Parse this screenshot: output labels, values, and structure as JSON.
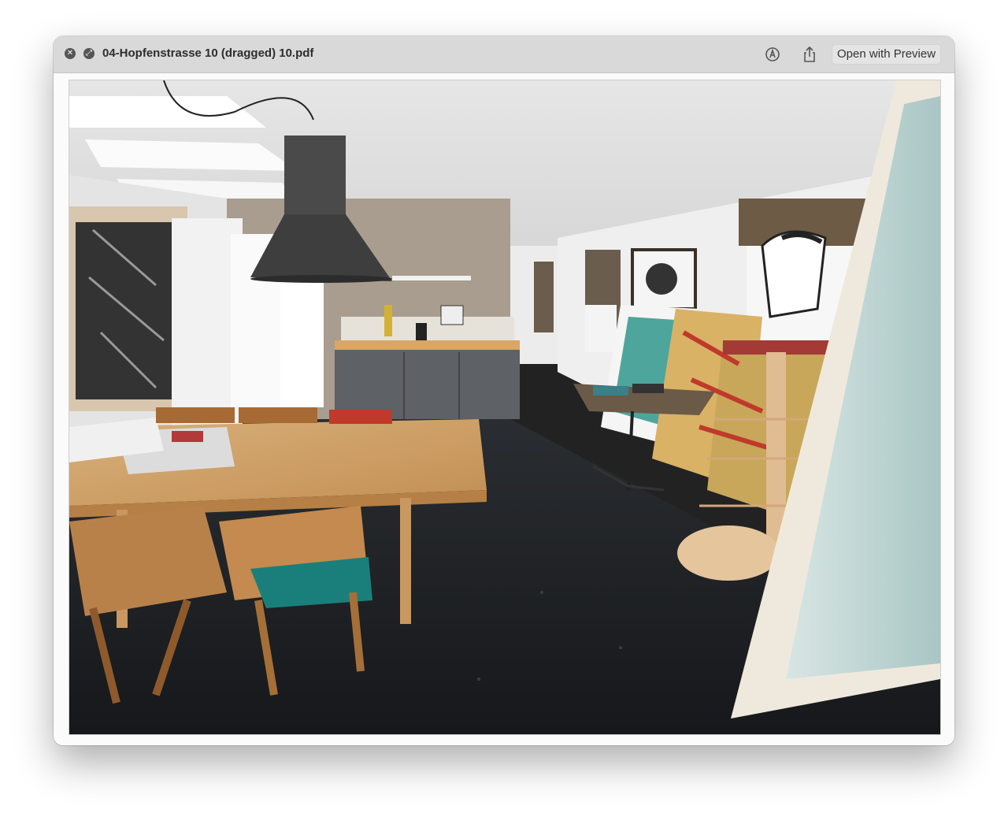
{
  "window": {
    "title": "04-Hopfenstrasse 10 (dragged) 10.pdf",
    "open_with_label": "Open with Preview"
  },
  "titlebar": {
    "close_icon": "close-icon",
    "fullscreen_icon": "fullscreen-icon",
    "markup_icon": "markup-icon",
    "share_icon": "share-icon"
  },
  "document": {
    "content": "photo-of-office-interior"
  }
}
